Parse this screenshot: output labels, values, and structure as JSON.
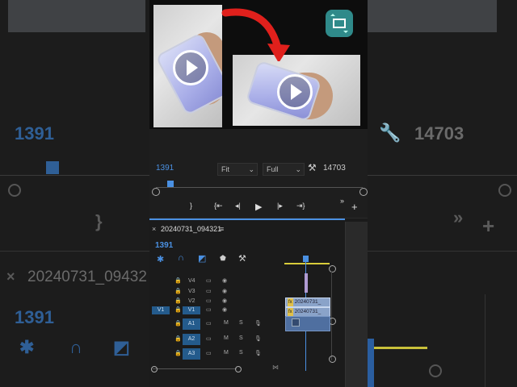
{
  "monitor": {
    "timecode_left": "1391",
    "fit_label": "Fit",
    "full_label": "Full",
    "timecode_right": "14703"
  },
  "sequence": {
    "name": "20240731_094321",
    "timecode": "1391"
  },
  "tracks": {
    "video": [
      "V4",
      "V3",
      "V2",
      "V1"
    ],
    "audio": [
      "A1",
      "A2",
      "A3"
    ],
    "source_patch": "V1",
    "ms": [
      "M",
      "S"
    ]
  },
  "clips": {
    "v2": "20240731_",
    "v1": "20240731_"
  },
  "background": {
    "left_tc": "1391",
    "right_tc": "14703",
    "left_seq": "20240731_09432",
    "left_tc2": "1391"
  },
  "colors": {
    "accent": "#4a90e2",
    "track_blue": "#245b8c",
    "yellow": "#e0c04a",
    "arrow_red": "#e0201c"
  },
  "icons": [
    "play-icon",
    "wrench-icon",
    "step-back-icon",
    "step-forward-icon",
    "go-in-icon",
    "go-out-icon",
    "marker-icon",
    "eye-icon",
    "lock-icon",
    "mic-icon",
    "film-icon",
    "add-icon",
    "more-icon",
    "magnet-icon",
    "snap-icon"
  ]
}
